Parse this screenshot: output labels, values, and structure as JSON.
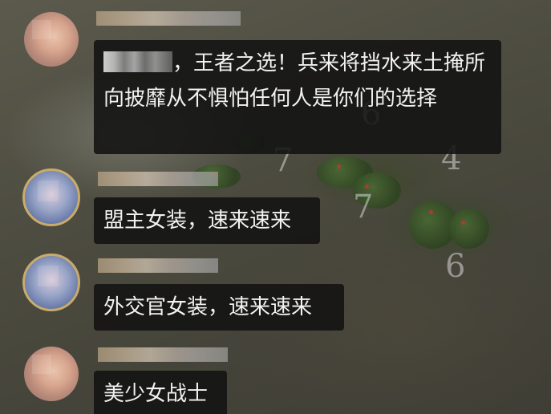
{
  "map": {
    "numbers": [
      "6",
      "4",
      "7",
      "7",
      "6"
    ]
  },
  "messages": [
    {
      "avatar_icon": "user-avatar-icon",
      "sender": "",
      "text_suffix": "，王者之选！兵来将挡水来土掩所向披靡从不惧怕任何人是你们的选择",
      "has_mention": true
    },
    {
      "avatar_icon": "user-avatar-icon",
      "sender": "",
      "text": "盟主女装，速来速来"
    },
    {
      "avatar_icon": "user-avatar-icon",
      "sender": "",
      "text": "外交官女装，速来速来"
    },
    {
      "avatar_icon": "user-avatar-icon",
      "sender": "",
      "text": "美少女战士"
    }
  ]
}
